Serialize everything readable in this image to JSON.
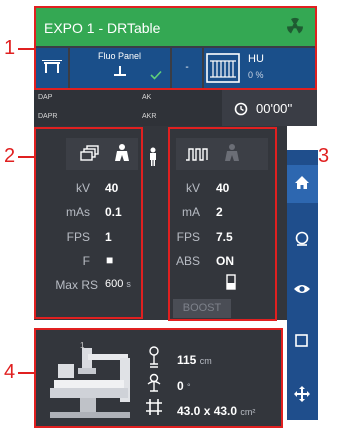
{
  "callouts": [
    "1",
    "2",
    "3",
    "4"
  ],
  "header": {
    "title": "EXPO 1 - DRTable",
    "radiation_icon": "radiation-icon"
  },
  "detector": {
    "label": "Fluo Panel",
    "dash": "-",
    "hu_label": "HU",
    "hu_value": "0 %"
  },
  "dose": {
    "dap": "DAP",
    "ak": "AK",
    "dapr": "DAPR",
    "akr": "AKR",
    "timer": "00'00''"
  },
  "mode_left": {
    "params": [
      {
        "label": "kV",
        "value": "40"
      },
      {
        "label": "mAs",
        "value": "0.1"
      },
      {
        "label": "FPS",
        "value": "1"
      },
      {
        "label": "F",
        "value": "■"
      }
    ],
    "max_rs_label": "Max RS",
    "max_rs_value": "600",
    "max_rs_unit": "s"
  },
  "mode_right": {
    "params": [
      {
        "label": "kV",
        "value": "40"
      },
      {
        "label": "mA",
        "value": "2"
      },
      {
        "label": "FPS",
        "value": "7.5"
      },
      {
        "label": "ABS",
        "value": "ON"
      }
    ],
    "boost_label": "BOOST"
  },
  "geometry_info": {
    "position_number": "1",
    "sid_value": "115",
    "sid_unit": "cm",
    "angle_value": "0",
    "angle_unit": "°",
    "field_value": "43.0 x 43.0",
    "field_unit": "cm²"
  },
  "colors": {
    "green": "#34a853",
    "blue": "#1a4f8a",
    "sidebar": "#1f4e8c",
    "callout": "#e02020",
    "panel": "#33363c"
  }
}
